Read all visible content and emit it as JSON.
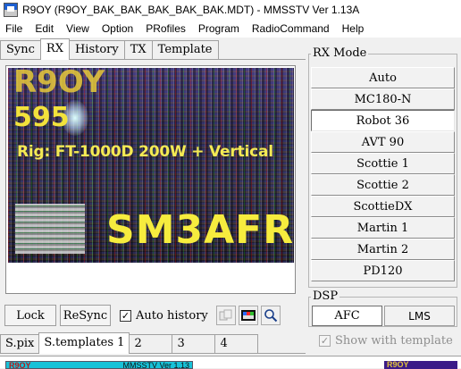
{
  "window": {
    "title": "R9OY (R9OY_BAK_BAK_BAK_BAK_BAK.MDT) - MMSSTV Ver 1.13A"
  },
  "menu": [
    "File",
    "Edit",
    "View",
    "Option",
    "PRofiles",
    "Program",
    "RadioCommand",
    "Help"
  ],
  "top_tabs": [
    "Sync",
    "RX",
    "History",
    "TX",
    "Template"
  ],
  "top_tabs_active": "RX",
  "rx_image": {
    "callsign_top": "R9OY",
    "report": "595",
    "rig_line": "Rig: FT-1000D 200W + Vertical",
    "callsign_bottom": "SM3AFR"
  },
  "controls": {
    "lock_label": "Lock",
    "resync_label": "ReSync",
    "auto_history_label": "Auto history",
    "auto_history_checked": true,
    "check_mark": "✓"
  },
  "rx_mode": {
    "title": "RX Mode",
    "modes": [
      "Auto",
      "MC180-N",
      "Robot 36",
      "AVT 90",
      "Scottie 1",
      "Scottie 2",
      "ScottieDX",
      "Martin 1",
      "Martin 2",
      "PD120"
    ],
    "selected": "Robot 36"
  },
  "dsp": {
    "title": "DSP",
    "afc_label": "AFC",
    "lms_label": "LMS"
  },
  "bottom_tabs": [
    "S.pix",
    "S.templates 1",
    "2",
    "3",
    "4"
  ],
  "bottom_tabs_active": "S.templates 1",
  "show_with_template": {
    "label": "Show with template",
    "checked": true
  },
  "thumbnails": {
    "first_left": "R9OY",
    "first_right": "MMSSTV Ver 1.13",
    "second_left": "R9OY"
  },
  "colors": {
    "thumb_cyan": "#17c2d8",
    "thumb_purple": "#3b1b88",
    "sstv_text_yellow": "#f6ec3e"
  }
}
